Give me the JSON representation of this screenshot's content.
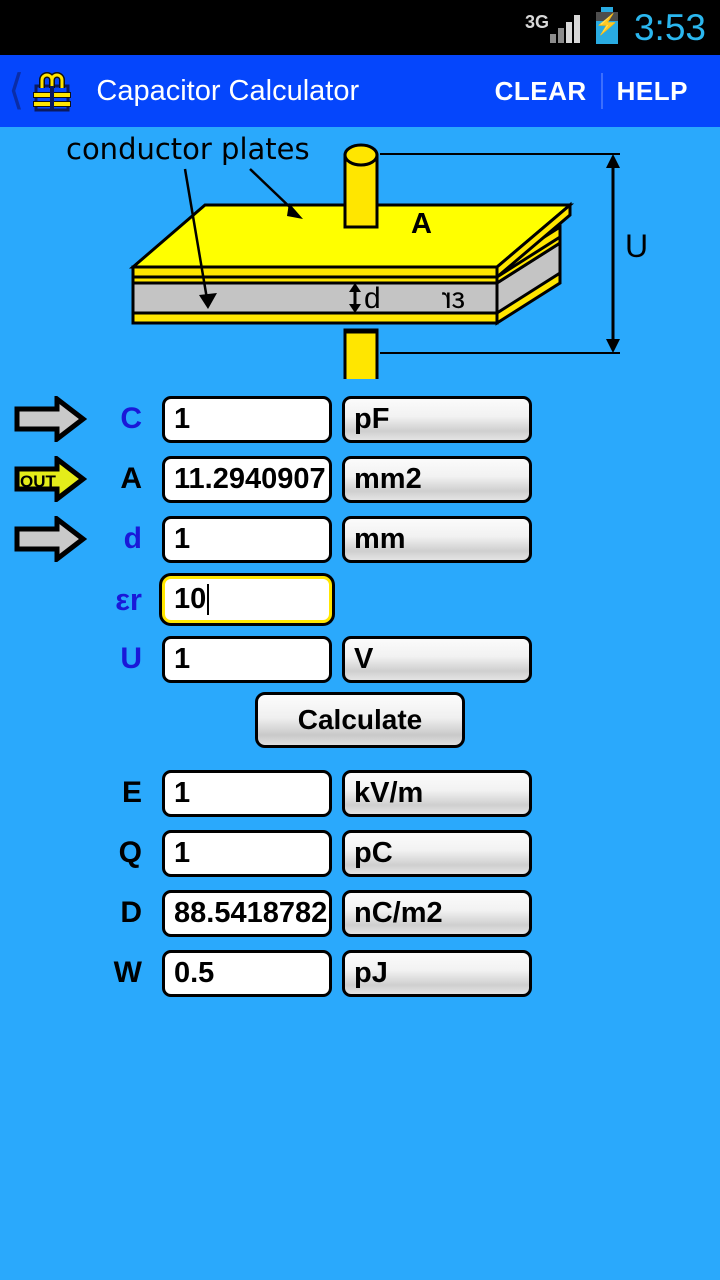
{
  "statusbar": {
    "network": "3G",
    "signal_icon": "signal-bars-icon",
    "battery_icon": "battery-charging-icon",
    "time": "3:53"
  },
  "titlebar": {
    "back_icon": "back-chevron-icon",
    "app_icon": "capacitor-icon",
    "title": "Capacitor Calculator",
    "clear_label": "CLEAR",
    "help_label": "HELP",
    "accent_color": "#0546fc"
  },
  "diagram": {
    "name": "parallel-plate-capacitor-diagram",
    "caption": "conductor plates",
    "label_area": "A",
    "label_distance": "d",
    "label_permittivity": "εr",
    "label_voltage": "U",
    "plate_color": "#ffff00",
    "dielectric_color": "#c4c4c4",
    "background_color": "#2aa9fc"
  },
  "form": {
    "rows": [
      {
        "arrow": "in",
        "arrow_label": "",
        "label": "C",
        "label_kind": "in",
        "value": "1",
        "unit": "pF",
        "focused": false,
        "has_unit": true
      },
      {
        "arrow": "out",
        "arrow_label": "OUT",
        "label": "A",
        "label_kind": "out",
        "value": "11.2940907",
        "unit": "mm2",
        "focused": false,
        "has_unit": true
      },
      {
        "arrow": "in",
        "arrow_label": "",
        "label": "d",
        "label_kind": "in",
        "value": "1",
        "unit": "mm",
        "focused": false,
        "has_unit": true
      },
      {
        "arrow": "none",
        "arrow_label": "",
        "label": "εr",
        "label_kind": "in",
        "value": "10",
        "unit": "",
        "focused": true,
        "has_unit": false
      },
      {
        "arrow": "none",
        "arrow_label": "",
        "label": "U",
        "label_kind": "in",
        "value": "1",
        "unit": "V",
        "focused": false,
        "has_unit": true
      }
    ],
    "calculate_label": "Calculate",
    "results": [
      {
        "label": "E",
        "value": "1",
        "unit": "kV/m"
      },
      {
        "label": "Q",
        "value": "1",
        "unit": "pC"
      },
      {
        "label": "D",
        "value": "88.5418782",
        "unit": "nC/m2"
      },
      {
        "label": "W",
        "value": "0.5",
        "unit": "pJ"
      }
    ]
  },
  "colors": {
    "page_background": "#2aa9fc",
    "input_label": "#1a18d8",
    "output_label": "#000000",
    "focus_border": "#ffe600"
  }
}
